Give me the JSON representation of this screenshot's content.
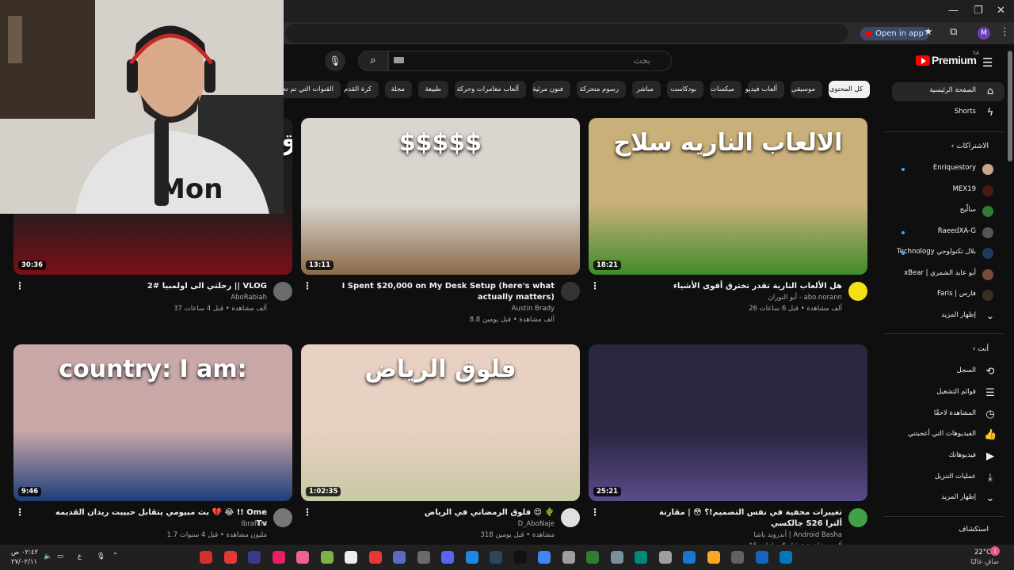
{
  "browser": {
    "open_in_app": "Open in app",
    "profile_initial": "M"
  },
  "header": {
    "logo_text": "Premium",
    "region": "SA",
    "search_placeholder": "بحث"
  },
  "chips": [
    "كل المحتوى",
    "موسيقى",
    "ألعاب فيديو",
    "ميكسات",
    "بودكاست",
    "مباشر",
    "رسوم متحركة",
    "فنون مرئية",
    "ألعاب مغامرات وحركة",
    "طبيعة",
    "مجلة",
    "كرة القدم",
    "القنوات التي تم تحميلها مؤخرًا"
  ],
  "sidebar": {
    "home": "الصفحة الرئيسية",
    "shorts": "Shorts",
    "subscriptions_heading": "الاشتراكات",
    "subscriptions": [
      {
        "name": "Enriquestory",
        "live": true,
        "color": "#c9a48a"
      },
      {
        "name": "MEX19",
        "live": false,
        "color": "#4a1a1a"
      },
      {
        "name": "سالْيح",
        "live": false,
        "color": "#2e7d32"
      },
      {
        "name": "RaeedXA-G",
        "live": true,
        "color": "#555555"
      },
      {
        "name": "بلال تكنولوجي Technology",
        "live": true,
        "color": "#1e3a5f"
      },
      {
        "name": "أبو عابد الشمري | xBear",
        "live": false,
        "color": "#7a4b3a"
      },
      {
        "name": "فارس | Faris",
        "live": false,
        "color": "#3b2f1f"
      }
    ],
    "show_more": "إظهار المزيد",
    "you_heading": "أنت",
    "you_items": [
      {
        "label": "السجل",
        "icon": "history-icon",
        "glyph": "⟲"
      },
      {
        "label": "قوائم التشغيل",
        "icon": "playlists-icon",
        "glyph": "☰"
      },
      {
        "label": "المشاهدة لاحقًا",
        "icon": "watch-later-icon",
        "glyph": "◷"
      },
      {
        "label": "الفيديوهات التي أعجبتني",
        "icon": "like-icon",
        "glyph": "👍"
      },
      {
        "label": "فيديوهاتك",
        "icon": "your-videos-icon",
        "glyph": "▶"
      },
      {
        "label": "عمليات التنزيل",
        "icon": "download-icon",
        "glyph": "⤓"
      }
    ],
    "show_more_2": "إظهار المزيد",
    "explore_heading": "استكشاف"
  },
  "videos": [
    {
      "duration": "18:21",
      "title": "هل الألعاب النارية تقدر تخترق أقوى الأشياء",
      "channel": "أبو النوران - abo.norann",
      "meta": "26 ألف مشاهدة • قبل 6 ساعات",
      "thumb_color_a": "#c9b07a",
      "thumb_color_b": "#3f8b2a",
      "avatar_color": "#f2e012",
      "thumb_text": "الالعاب الناريه سلاح"
    },
    {
      "duration": "13:11",
      "title": "I Spent $20,000 on My Desk Setup (here's what actually matters)",
      "channel": "Austin Brady",
      "meta": "8.8 ألف مشاهدة • قبل يومين",
      "thumb_color_a": "#d9d5cf",
      "thumb_color_b": "#8a6a48",
      "avatar_color": "#333333",
      "thumb_text": "$$$$$"
    },
    {
      "duration": "30:36",
      "title": "رحلتي الى اولمبيا #2 || VLOG",
      "channel": "AboRabiah",
      "meta": "37 ألف مشاهدة • قبل 4 ساعات",
      "thumb_color_a": "#1d1d1d",
      "thumb_color_b": "#7a0f17",
      "avatar_color": "#6b6b6b",
      "thumb_text": "فلوق ٢ تجهيز اولومبيا ٢٠٢٦"
    },
    {
      "duration": "25:21",
      "title": "تغييرات مخفية في نفس التصميم!؟ 😳 | مقارنة جالكسي S26 ألترا",
      "channel": "أندرويد باشا | Android Basha",
      "meta": "15 ألف مشاهدة • قبل 6 ساعات",
      "thumb_color_a": "#2a2540",
      "thumb_color_b": "#5a4b8a",
      "avatar_color": "#43a047",
      "thumb_text": ""
    },
    {
      "duration": "1:02:35",
      "title": "فلوق الرمضاني في الرياض 😍 🌵",
      "channel": "D_AboNaje",
      "meta": "318 مشاهدة • قبل يومين",
      "thumb_color_a": "#e8d0c2",
      "thumb_color_b": "#c7c9a4",
      "avatar_color": "#e0e0e0",
      "thumb_text": "فلوق الرياض"
    },
    {
      "duration": "9:46",
      "title": "بث مبيومي يتقابل حبيبت ريدان القديمه 💔 😂 !! Ome Tv",
      "channel": "Ibrahim",
      "meta": "1.7 مليون مشاهدة • قبل 4 سنوات",
      "thumb_color_a": "#c9a8a8",
      "thumb_color_b": "#1e3d7a",
      "avatar_color": "#777777",
      "thumb_text": "country:  I am:"
    }
  ],
  "taskbar": {
    "weather_temp": "22°C",
    "weather_desc": "صافٍ غالبًا",
    "time": "٠٢:٤٢ ص",
    "date": "٢٧/٠٢/١١",
    "lang": "ع",
    "notification_count": "1"
  }
}
